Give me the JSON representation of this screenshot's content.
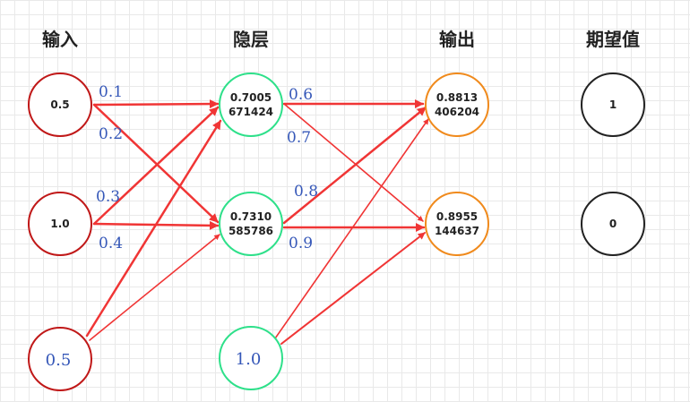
{
  "headers": {
    "input": "输入",
    "hidden": "隐层",
    "output": "输出",
    "expected": "期望值"
  },
  "nodes": {
    "input1": "0.5",
    "input2": "1.0",
    "input_bias": "0.5",
    "hidden1_line1": "0.7005",
    "hidden1_line2": "671424",
    "hidden2_line1": "0.7310",
    "hidden2_line2": "585786",
    "hidden_bias": "1.0",
    "output1_line1": "0.8813",
    "output1_line2": "406204",
    "output2_line1": "0.8955",
    "output2_line2": "144637",
    "expected1": "1",
    "expected2": "0"
  },
  "weights": {
    "w1": "0.1",
    "w2": "0.2",
    "w3": "0.3",
    "w4": "0.4",
    "w5": "0.6",
    "w6": "0.7",
    "w7": "0.8",
    "w8": "0.9"
  },
  "colors": {
    "input_stroke": "#c01818",
    "hidden_stroke": "#2ee08a",
    "output_stroke": "#f08a1c",
    "expected_stroke": "#222222",
    "arrow": "#f03535",
    "weight_text": "#3557b8"
  }
}
